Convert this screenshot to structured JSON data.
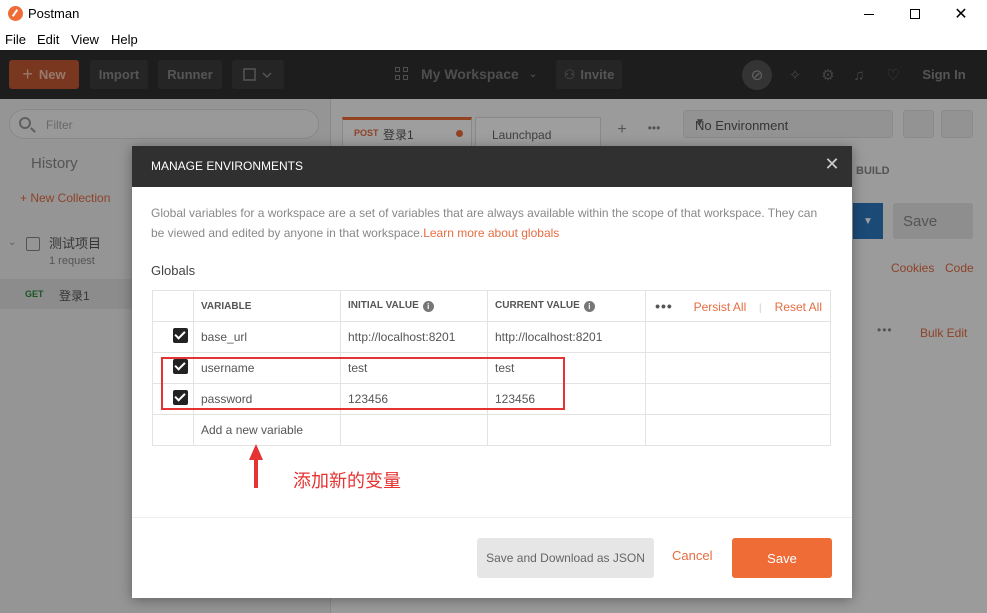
{
  "window": {
    "title": "Postman"
  },
  "menu": [
    "File",
    "Edit",
    "View",
    "Help"
  ],
  "toolbar": {
    "new_label": "New",
    "import_label": "Import",
    "runner_label": "Runner",
    "workspace_label": "My Workspace",
    "invite_label": "Invite",
    "signin_label": "Sign In"
  },
  "sidebar": {
    "search_placeholder": "Filter",
    "tab_history": "History",
    "new_collection": "+ New Collection",
    "collection": {
      "name": "测试项目",
      "count": "1 request"
    },
    "request": {
      "method": "GET",
      "name": "登录1"
    }
  },
  "main": {
    "tabs": [
      {
        "method": "POST",
        "name": "登录1"
      },
      {
        "name": "Launchpad"
      }
    ],
    "environment": "No Environment",
    "build_label": "BUILD",
    "save_label": "Save",
    "cookies_label": "Cookies",
    "code_label": "Code",
    "bulk_edit_label": "Bulk Edit"
  },
  "modal": {
    "title": "MANAGE ENVIRONMENTS",
    "description": "Global variables for a workspace are a set of variables that are always available within the scope of that workspace. They can be viewed and edited by anyone in that workspace.",
    "description_link": "Learn more about globals",
    "globals_label": "Globals",
    "headers": {
      "variable": "VARIABLE",
      "initial": "INITIAL VALUE",
      "current": "CURRENT VALUE",
      "persist_all": "Persist All",
      "reset_all": "Reset All"
    },
    "rows": [
      {
        "variable": "base_url",
        "initial": "http://localhost:8201",
        "current": "http://localhost:8201"
      },
      {
        "variable": "username",
        "initial": "test",
        "current": "test"
      },
      {
        "variable": "password",
        "initial": "123456",
        "current": "123456"
      }
    ],
    "new_variable_placeholder": "Add a new variable",
    "annotation": "添加新的变量",
    "buttons": {
      "save_download": "Save and Download as JSON",
      "cancel": "Cancel",
      "save": "Save"
    }
  },
  "colors": {
    "accent": "#ef6c37",
    "header": "#303030",
    "annotation": "#e53333"
  }
}
